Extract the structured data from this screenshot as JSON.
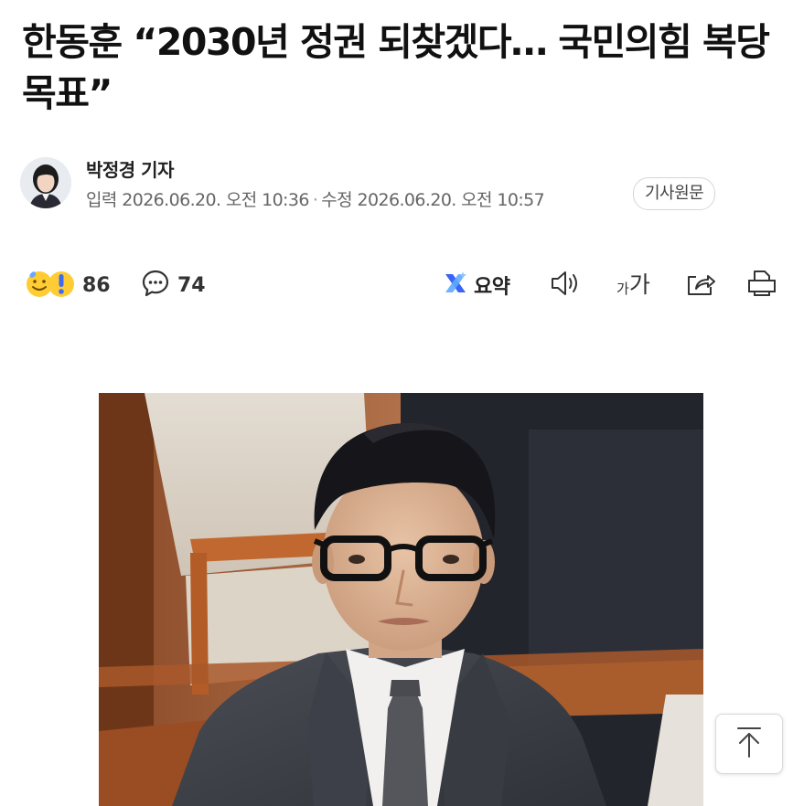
{
  "article": {
    "headline": "한동훈 “2030년 정권 되찾겠다… 국민의힘 복당 목표”"
  },
  "author": {
    "name": "박정경 기자",
    "published_label": "입력",
    "published": "2026.06.20. 오전 10:36",
    "separator": "·",
    "modified_label": "수정",
    "modified": "2026.06.20. 오전 10:57",
    "original_link": "기사원문"
  },
  "toolbar": {
    "reactions_count": "86",
    "comments_count": "74",
    "summary_label": "요약",
    "font_small": "가",
    "font_large": "가"
  },
  "icons": {
    "reaction": "reaction-emoji-icon",
    "comment": "speech-bubble-icon",
    "summary": "ai-summary-icon",
    "listen": "speaker-icon",
    "font": "font-size-icon",
    "share": "share-icon",
    "print": "print-icon",
    "top": "arrow-up-icon"
  },
  "colors": {
    "summary_accent": "#3b63f5",
    "reaction_yellow": "#ffcc33",
    "text_primary": "#111111",
    "text_secondary": "#666666"
  }
}
